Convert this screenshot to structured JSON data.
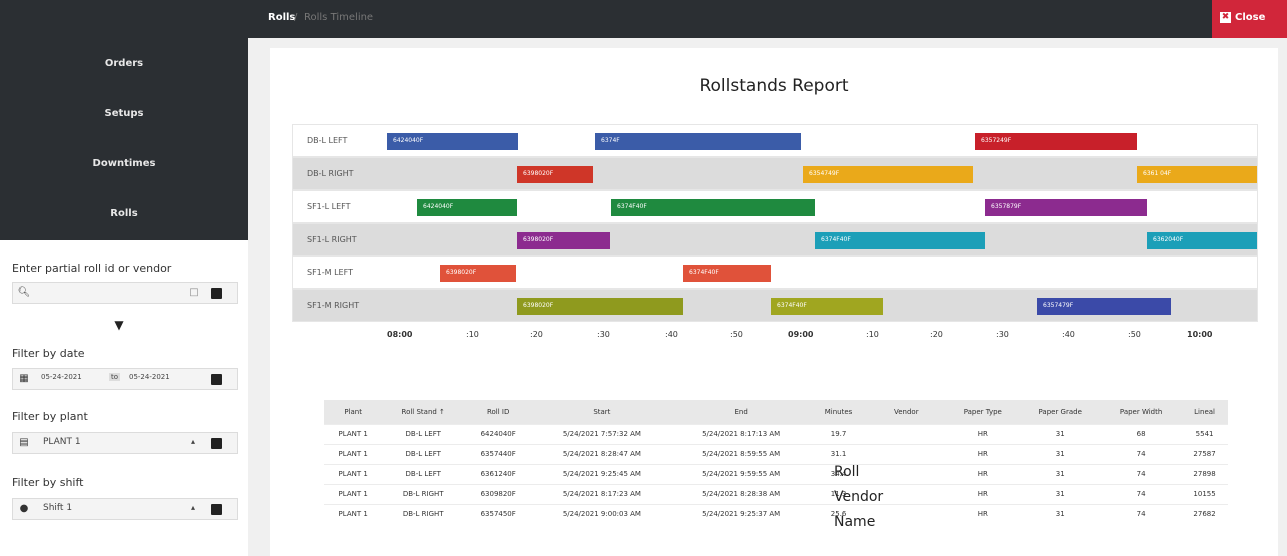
{
  "nav": {
    "items": [
      {
        "label": "Orders"
      },
      {
        "label": "Setups"
      },
      {
        "label": "Downtimes"
      },
      {
        "label": "Rolls"
      }
    ]
  },
  "topbar": {
    "breadcrumb_root": "Rolls",
    "breadcrumb_sep": "/",
    "breadcrumb_current": "Rolls Timeline",
    "close_label": "Close"
  },
  "filters": {
    "search_label": "Enter partial roll id or vendor",
    "date_label": "Filter by date",
    "date_from": "05-24-2021",
    "date_to_prefix": "to",
    "date_to": "05-24-2021",
    "plant_label": "Filter by plant",
    "plant_value": "PLANT 1",
    "shift_label": "Filter by shift",
    "shift_value": "Shift 1"
  },
  "report": {
    "title": "Rollstands Report"
  },
  "timeline": {
    "rows": [
      {
        "label": "DB-L LEFT",
        "bars": [
          {
            "color": "#3b5ca8",
            "label": "6424040F"
          },
          {
            "color": "#3b5ca8",
            "label": "6374F"
          },
          {
            "color": "#c8202a",
            "label": "6357249F"
          }
        ]
      },
      {
        "label": "DB-L RIGHT",
        "bars": [
          {
            "color": "#cf3628",
            "label": "6398020F"
          },
          {
            "color": "#eaa91a",
            "label": "6354749F"
          },
          {
            "color": "#eaa91a",
            "label": "6361 04F"
          }
        ]
      },
      {
        "label": "SF1-L LEFT",
        "bars": [
          {
            "color": "#1f8a3f",
            "label": "6424040F"
          },
          {
            "color": "#1f8a3f",
            "label": "6374F40F"
          },
          {
            "color": "#8c2b8f",
            "label": "6357879F"
          }
        ]
      },
      {
        "label": "SF1-L RIGHT",
        "bars": [
          {
            "color": "#8c2b8f",
            "label": "6398020F"
          },
          {
            "color": "#1c9fb8",
            "label": "6374F40F"
          },
          {
            "color": "#1c9fb8",
            "label": "6362040F"
          }
        ]
      },
      {
        "label": "SF1-M LEFT",
        "bars": [
          {
            "color": "#e0523a",
            "label": "6398020F"
          },
          {
            "color": "#e0523a",
            "label": "6374F40F"
          }
        ]
      },
      {
        "label": "SF1-M RIGHT",
        "bars": [
          {
            "color": "#8f9a1e",
            "label": "6398020F"
          },
          {
            "color": "#a0a620",
            "label": "6374F40F"
          },
          {
            "color": "#3b4aa8",
            "label": "6357479F"
          }
        ]
      }
    ],
    "axis": [
      "08:00",
      ":10",
      ":20",
      ":30",
      ":40",
      ":50",
      "09:00",
      ":10",
      ":20",
      ":30",
      ":40",
      ":50",
      "10:00"
    ]
  },
  "table": {
    "headers": [
      "Plant",
      "Roll Stand ↑",
      "Roll ID",
      "Start",
      "End",
      "Minutes",
      "Vendor",
      "Paper Type",
      "Paper Grade",
      "Paper Width",
      "Lineal"
    ],
    "rows": [
      [
        "PLANT 1",
        "DB-L LEFT",
        "6424040F",
        "5/24/2021 7:57:32 AM",
        "5/24/2021 8:17:13 AM",
        "19.7",
        "",
        "HR",
        "31",
        "68",
        "5541"
      ],
      [
        "PLANT 1",
        "DB-L LEFT",
        "6357440F",
        "5/24/2021 8:28:47 AM",
        "5/24/2021 8:59:55 AM",
        "31.1",
        "",
        "HR",
        "31",
        "74",
        "27587"
      ],
      [
        "PLANT 1",
        "DB-L LEFT",
        "6361240F",
        "5/24/2021 9:25:45 AM",
        "5/24/2021 9:59:55 AM",
        "34.4",
        "",
        "HR",
        "31",
        "74",
        "27898"
      ],
      [
        "PLANT 1",
        "DB-L RIGHT",
        "6309820F",
        "5/24/2021 8:17:23 AM",
        "5/24/2021 8:28:38 AM",
        "11.3",
        "",
        "HR",
        "31",
        "74",
        "10155"
      ],
      [
        "PLANT 1",
        "DB-L RIGHT",
        "6357450F",
        "5/24/2021 9:00:03 AM",
        "5/24/2021 9:25:37 AM",
        "25.6",
        "",
        "HR",
        "31",
        "74",
        "27682"
      ]
    ],
    "vendor_overlay": [
      "Roll",
      "Vendor",
      "Name"
    ]
  },
  "colors": {
    "dark": "#2b2f33",
    "close_red": "#d1263a"
  }
}
